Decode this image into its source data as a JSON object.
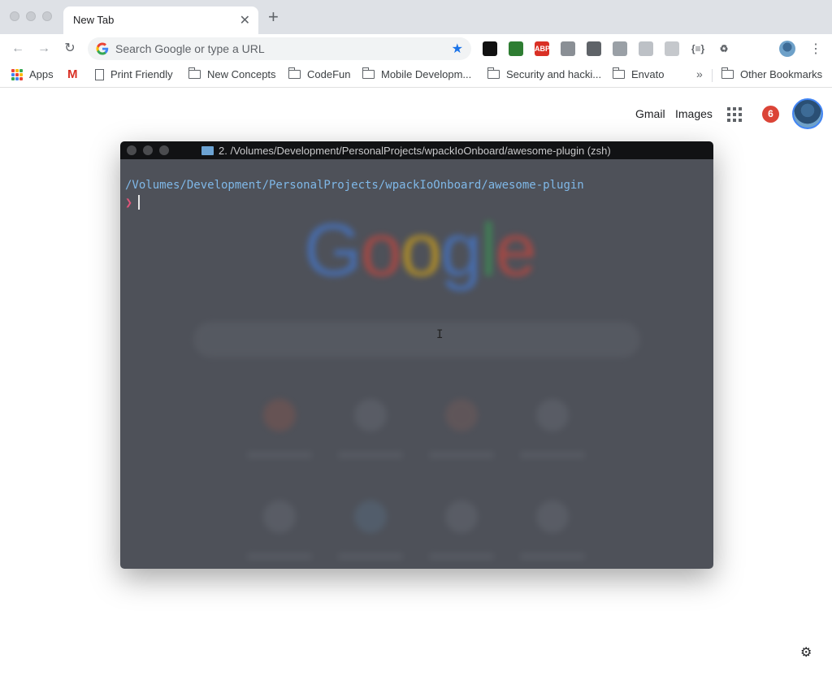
{
  "tab": {
    "title": "New Tab"
  },
  "omnibox": {
    "placeholder": "Search Google or type a URL"
  },
  "bookmarks": {
    "apps": "Apps",
    "items": [
      "Print Friendly",
      "New Concepts",
      "CodeFun",
      "Mobile Developm...",
      "Security and hacki...",
      "Envato"
    ],
    "overflow": "»",
    "other": "Other Bookmarks"
  },
  "google": {
    "gmail": "Gmail",
    "images": "Images",
    "notification_count": "6"
  },
  "terminal": {
    "title": "2. /Volumes/Development/PersonalProjects/wpackIoOnboard/awesome-plugin (zsh)",
    "cwd": "/Volumes/Development/PersonalProjects/wpackIoOnboard/awesome-plugin",
    "prompt": "❯"
  },
  "extensions": [
    {
      "name": "tweetdeck-icon",
      "color": "#111111",
      "label": ""
    },
    {
      "name": "evernote-icon",
      "color": "#2e7d32",
      "label": ""
    },
    {
      "name": "adblock-plus-icon",
      "color": "#d93025",
      "label": "ABP"
    },
    {
      "name": "vimium-icon",
      "color": "#8a8f95",
      "label": ""
    },
    {
      "name": "screenshot-icon",
      "color": "#5f6368",
      "label": ""
    },
    {
      "name": "drive-icon",
      "color": "#9aa0a6",
      "label": ""
    },
    {
      "name": "extension-box-icon",
      "color": "#bdc1c6",
      "label": ""
    },
    {
      "name": "target-icon",
      "color": "#c5c8cc",
      "label": ""
    },
    {
      "name": "json-viewer-icon",
      "color": "#ffffff",
      "label": "{≡}"
    },
    {
      "name": "recycle-icon",
      "color": "#ffffff",
      "label": "♻"
    },
    {
      "name": "fox-icon",
      "color": "#ffffff",
      "label": ""
    }
  ]
}
